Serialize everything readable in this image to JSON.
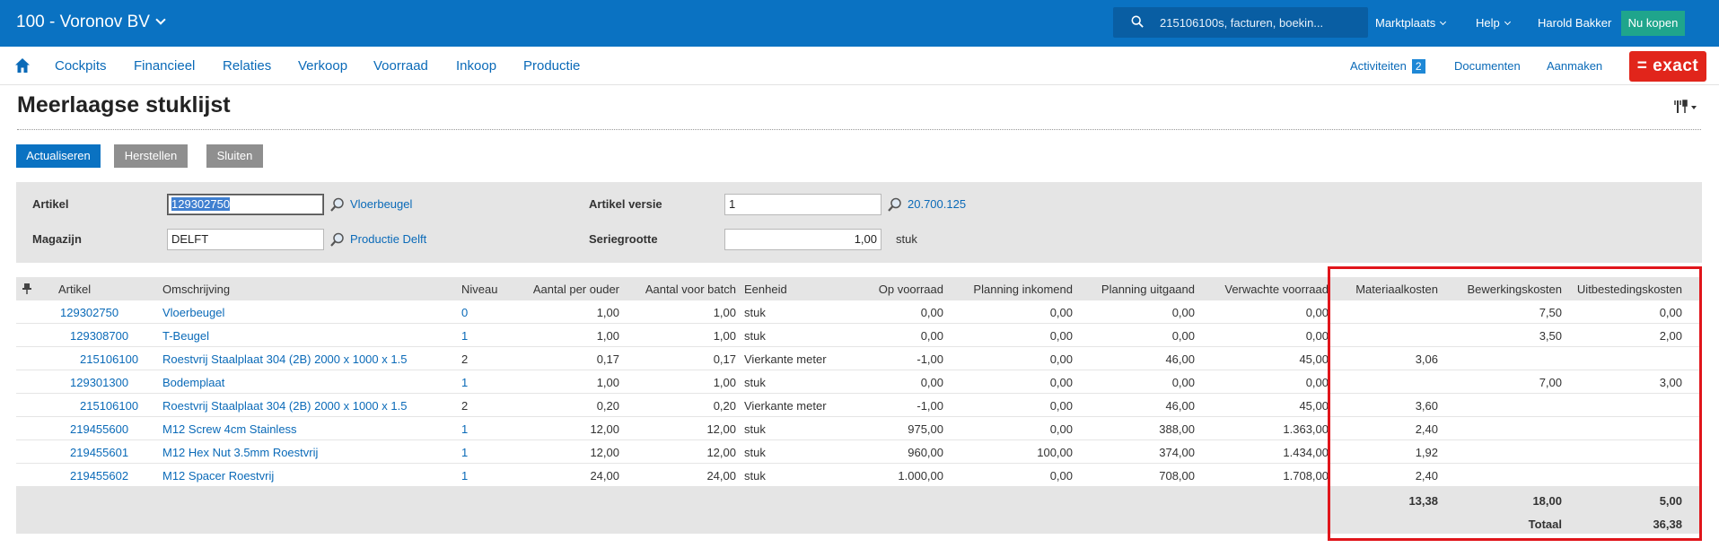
{
  "topbar": {
    "company": "100 - Voronov BV",
    "search_text": "215106100s, facturen, boekin...",
    "marketplace": "Marktplaats",
    "help": "Help",
    "user": "Harold Bakker",
    "buy_now": "Nu kopen"
  },
  "nav": {
    "items": [
      "Cockpits",
      "Financieel",
      "Relaties",
      "Verkoop",
      "Voorraad",
      "Inkoop",
      "Productie"
    ],
    "activities": "Activiteiten",
    "activities_count": "2",
    "documents": "Documenten",
    "create": "Aanmaken",
    "brand": "= exact"
  },
  "page": {
    "title": "Meerlaagse stuklijst"
  },
  "buttons": {
    "refresh": "Actualiseren",
    "reset": "Herstellen",
    "close": "Sluiten"
  },
  "filters": {
    "article_label": "Artikel",
    "article_value": "129302750",
    "article_desc": "Vloerbeugel",
    "warehouse_label": "Magazijn",
    "warehouse_value": "DELFT",
    "warehouse_desc": "Productie Delft",
    "version_label": "Artikel versie",
    "version_value": "1",
    "version_desc": "20.700.125",
    "batch_label": "Seriegrootte",
    "batch_value": "1,00",
    "batch_unit": "stuk"
  },
  "grid": {
    "columns": [
      "Artikel",
      "Omschrijving",
      "Niveau",
      "Aantal per ouder",
      "Aantal voor batch",
      "Eenheid",
      "Op voorraad",
      "Planning inkomend",
      "Planning uitgaand",
      "Verwachte voorraad",
      "Materiaalkosten",
      "Bewerkingskosten",
      "Uitbestedingskosten"
    ],
    "rows": [
      {
        "artikel": "129302750",
        "omschrijving": "Vloerbeugel",
        "niveau": "0",
        "per_ouder": "1,00",
        "batch": "1,00",
        "eenheid": "stuk",
        "voorraad": "0,00",
        "inkomend": "0,00",
        "uitgaand": "0,00",
        "verwacht": "0,00",
        "materiaal": "",
        "bewerking": "7,50",
        "uitbesteding": "0,00"
      },
      {
        "artikel": "129308700",
        "omschrijving": "T-Beugel",
        "niveau": "1",
        "per_ouder": "1,00",
        "batch": "1,00",
        "eenheid": "stuk",
        "voorraad": "0,00",
        "inkomend": "0,00",
        "uitgaand": "0,00",
        "verwacht": "0,00",
        "materiaal": "",
        "bewerking": "3,50",
        "uitbesteding": "2,00"
      },
      {
        "artikel": "215106100",
        "omschrijving": "Roestvrij Staalplaat 304 (2B) 2000 x 1000 x 1.5",
        "niveau": "2",
        "per_ouder": "0,17",
        "batch": "0,17",
        "eenheid": "Vierkante meter",
        "voorraad": "-1,00",
        "inkomend": "0,00",
        "uitgaand": "46,00",
        "verwacht": "45,00",
        "materiaal": "3,06",
        "bewerking": "",
        "uitbesteding": ""
      },
      {
        "artikel": "129301300",
        "omschrijving": "Bodemplaat",
        "niveau": "1",
        "per_ouder": "1,00",
        "batch": "1,00",
        "eenheid": "stuk",
        "voorraad": "0,00",
        "inkomend": "0,00",
        "uitgaand": "0,00",
        "verwacht": "0,00",
        "materiaal": "",
        "bewerking": "7,00",
        "uitbesteding": "3,00"
      },
      {
        "artikel": "215106100",
        "omschrijving": "Roestvrij Staalplaat 304 (2B) 2000 x 1000 x 1.5",
        "niveau": "2",
        "per_ouder": "0,20",
        "batch": "0,20",
        "eenheid": "Vierkante meter",
        "voorraad": "-1,00",
        "inkomend": "0,00",
        "uitgaand": "46,00",
        "verwacht": "45,00",
        "materiaal": "3,60",
        "bewerking": "",
        "uitbesteding": ""
      },
      {
        "artikel": "219455600",
        "omschrijving": "M12 Screw 4cm Stainless",
        "niveau": "1",
        "per_ouder": "12,00",
        "batch": "12,00",
        "eenheid": "stuk",
        "voorraad": "975,00",
        "inkomend": "0,00",
        "uitgaand": "388,00",
        "verwacht": "1.363,00",
        "materiaal": "2,40",
        "bewerking": "",
        "uitbesteding": ""
      },
      {
        "artikel": "219455601",
        "omschrijving": "M12 Hex Nut 3.5mm Roestvrij",
        "niveau": "1",
        "per_ouder": "12,00",
        "batch": "12,00",
        "eenheid": "stuk",
        "voorraad": "960,00",
        "inkomend": "100,00",
        "uitgaand": "374,00",
        "verwacht": "1.434,00",
        "materiaal": "1,92",
        "bewerking": "",
        "uitbesteding": ""
      },
      {
        "artikel": "219455602",
        "omschrijving": "M12 Spacer Roestvrij",
        "niveau": "1",
        "per_ouder": "24,00",
        "batch": "24,00",
        "eenheid": "stuk",
        "voorraad": "1.000,00",
        "inkomend": "0,00",
        "uitgaand": "708,00",
        "verwacht": "1.708,00",
        "materiaal": "2,40",
        "bewerking": "",
        "uitbesteding": ""
      }
    ],
    "totals": {
      "materiaal": "13,38",
      "bewerking": "18,00",
      "uitbesteding": "5,00",
      "total_label": "Totaal",
      "total_value": "36,38"
    }
  },
  "colors": {
    "topbar": "#0a72c2",
    "link": "#0a6ab8",
    "brand": "#e1251b",
    "highlight_box": "#e0151b",
    "buy_button": "#1fa58c"
  }
}
